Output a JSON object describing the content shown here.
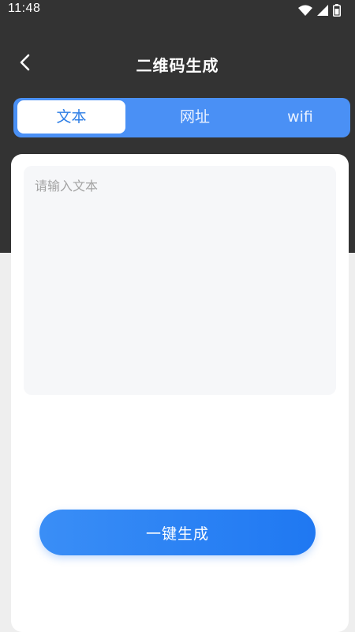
{
  "status_bar": {
    "time": "11:48",
    "icons": [
      "wifi-icon",
      "cellular-signal-icon",
      "battery-icon"
    ]
  },
  "header": {
    "title": "二维码生成",
    "back_icon": "chevron-left-icon"
  },
  "tabs": [
    {
      "label": "文本",
      "active": true
    },
    {
      "label": "网址",
      "active": false
    },
    {
      "label": "wifi",
      "active": false
    }
  ],
  "input": {
    "value": "",
    "placeholder": "请输入文本"
  },
  "actions": {
    "generate_label": "一键生成"
  },
  "colors": {
    "header_bg": "#333333",
    "tab_bar_bg": "#4a90f5",
    "active_tab_text": "#2f7fe6",
    "button_bg": "#1f78f2",
    "page_bg": "#eeeeee"
  }
}
